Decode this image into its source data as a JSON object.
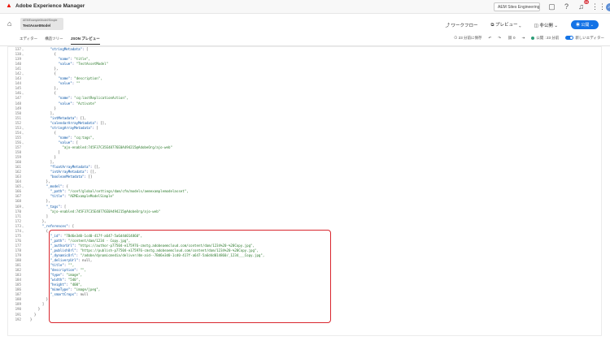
{
  "app": {
    "title": "Adobe Experience Manager",
    "org": "AEM Sites Engineering"
  },
  "top_icons": [
    "help-icon",
    "notifications-icon",
    "apps-icon",
    "avatar"
  ],
  "notifications_badge": "99",
  "avatar_initials": "JP",
  "document": {
    "path": "AEMExampleModel/Simple",
    "title": "TestAssetModel"
  },
  "header_actions": {
    "workflow": "ワークフロー",
    "preview": "プレビュー",
    "print": "非公開",
    "publish": "公開"
  },
  "tabs": {
    "editor": "エディター",
    "structure": "構造ツリー",
    "json": "JSON プレビュー"
  },
  "toolbar": {
    "saved": "23 分前に保存",
    "refs": "0",
    "status": "公開 : 23 分前",
    "new_editor": "新しいエディター"
  },
  "colors": {
    "highlight": "#d9262e",
    "accent": "#1473e6"
  },
  "code_lines": [
    {
      "n": "137",
      "f": "⌄",
      "t": "            \"stringMetadata\": ["
    },
    {
      "n": "138",
      "f": "⌄",
      "t": "              {"
    },
    {
      "n": "139",
      "f": "",
      "t": "                \"name\": \"title\","
    },
    {
      "n": "140",
      "f": "",
      "t": "                \"value\": \"TestAssetModel\""
    },
    {
      "n": "141",
      "f": "",
      "t": "              },"
    },
    {
      "n": "142",
      "f": "⌄",
      "t": "              {"
    },
    {
      "n": "143",
      "f": "",
      "t": "                \"name\": \"description\","
    },
    {
      "n": "144",
      "f": "",
      "t": "                \"value\": \"\""
    },
    {
      "n": "145",
      "f": "",
      "t": "              },"
    },
    {
      "n": "146",
      "f": "⌄",
      "t": "              {"
    },
    {
      "n": "147",
      "f": "",
      "t": "                \"name\": \"cq:lastReplicationAction\","
    },
    {
      "n": "148",
      "f": "",
      "t": "                \"value\": \"Activate\""
    },
    {
      "n": "149",
      "f": "",
      "t": "              }"
    },
    {
      "n": "150",
      "f": "",
      "t": "            ],"
    },
    {
      "n": "151",
      "f": "",
      "t": "            \"intMetadata\": [],"
    },
    {
      "n": "152",
      "f": "",
      "t": "            \"calendarArrayMetadata\": [],"
    },
    {
      "n": "153",
      "f": "⌄",
      "t": "            \"stringArrayMetadata\": ["
    },
    {
      "n": "154",
      "f": "⌄",
      "t": "              {"
    },
    {
      "n": "155",
      "f": "",
      "t": "                \"name\": \"cq:tags\","
    },
    {
      "n": "156",
      "f": "⌄",
      "t": "                \"value\": ["
    },
    {
      "n": "157",
      "f": "",
      "t": "                  \"ajo-enabled:745F37C35E48776E0A494215@AdobeOrg/ajo-web\""
    },
    {
      "n": "158",
      "f": "",
      "t": "                ]"
    },
    {
      "n": "159",
      "f": "",
      "t": "              }"
    },
    {
      "n": "160",
      "f": "",
      "t": "            ],"
    },
    {
      "n": "161",
      "f": "",
      "t": "            \"floatArrayMetadata\": [],"
    },
    {
      "n": "162",
      "f": "",
      "t": "            \"intArrayMetadata\": [],"
    },
    {
      "n": "163",
      "f": "",
      "t": "            \"booleanMetadata\": []"
    },
    {
      "n": "164",
      "f": "",
      "t": "          },"
    },
    {
      "n": "165",
      "f": "⌄",
      "t": "          \"_model\": {"
    },
    {
      "n": "166",
      "f": "",
      "t": "            \"_path\": \"/conf/global/settings/dam/cfm/models/aemexamplemodelasset\","
    },
    {
      "n": "167",
      "f": "",
      "t": "            \"title\": \"AEMExampleModelSimple\""
    },
    {
      "n": "168",
      "f": "",
      "t": "          },"
    },
    {
      "n": "169",
      "f": "⌄",
      "t": "          \"_tags\": ["
    },
    {
      "n": "170",
      "f": "",
      "t": "            \"ajo-enabled:745F37C35E48776E0A494215@AdobeOrg/ajo-web\""
    },
    {
      "n": "171",
      "f": "",
      "t": "          ]"
    },
    {
      "n": "172",
      "f": "",
      "t": "        },"
    },
    {
      "n": "173",
      "f": "⌄",
      "t": "        \"_references\": ["
    },
    {
      "n": "174",
      "f": "⌄",
      "t": "          {"
    },
    {
      "n": "175",
      "f": "",
      "t": "            \"_id\": \"7Bd6e3d0-1cd0-417f-a647-5a6d4d014860\","
    },
    {
      "n": "176",
      "f": "",
      "t": "            \"_path\": \"/content/dam/1234 - Copy.jpg\","
    },
    {
      "n": "177",
      "f": "",
      "t": "            \"_authorUrl\": \"https://author-p77504-e175976-cmstg.adobeaemcloud.com/content/dam/1234%20-%20Copy.jpg\","
    },
    {
      "n": "178",
      "f": "",
      "t": "            \"_publishUrl\": \"https://publish-p77504-e175976-cmstg.adobeaemcloud.com/content/dam/1234%20-%20Copy.jpg\","
    },
    {
      "n": "179",
      "f": "",
      "t": "            \"_dynamicUrl\": \"/adobe/dynamicmedia/deliver/dm-aid--7Bd6e3d0-1cd0-417f-a647-5a6d4d014860/_1234___Copy.jpg\","
    },
    {
      "n": "180",
      "f": "",
      "t": "            \"_deliveryUrl\": null,"
    },
    {
      "n": "181",
      "f": "",
      "t": "            \"title\": \"\","
    },
    {
      "n": "182",
      "f": "",
      "t": "            \"description\": \"\","
    },
    {
      "n": "183",
      "f": "",
      "t": "            \"type\": \"image\","
    },
    {
      "n": "184",
      "f": "",
      "t": "            \"width\": \"540\","
    },
    {
      "n": "185",
      "f": "",
      "t": "            \"height\": \"400\","
    },
    {
      "n": "186",
      "f": "",
      "t": "            \"mimeType\": \"image/jpeg\","
    },
    {
      "n": "187",
      "f": "",
      "t": "            \"_smartCrops\": null"
    },
    {
      "n": "188",
      "f": "",
      "t": "          }"
    },
    {
      "n": "189",
      "f": "",
      "t": "        ]"
    },
    {
      "n": "190",
      "f": "",
      "t": "      }"
    },
    {
      "n": "191",
      "f": "",
      "t": "    }"
    },
    {
      "n": "192",
      "f": "",
      "t": "  }"
    }
  ]
}
